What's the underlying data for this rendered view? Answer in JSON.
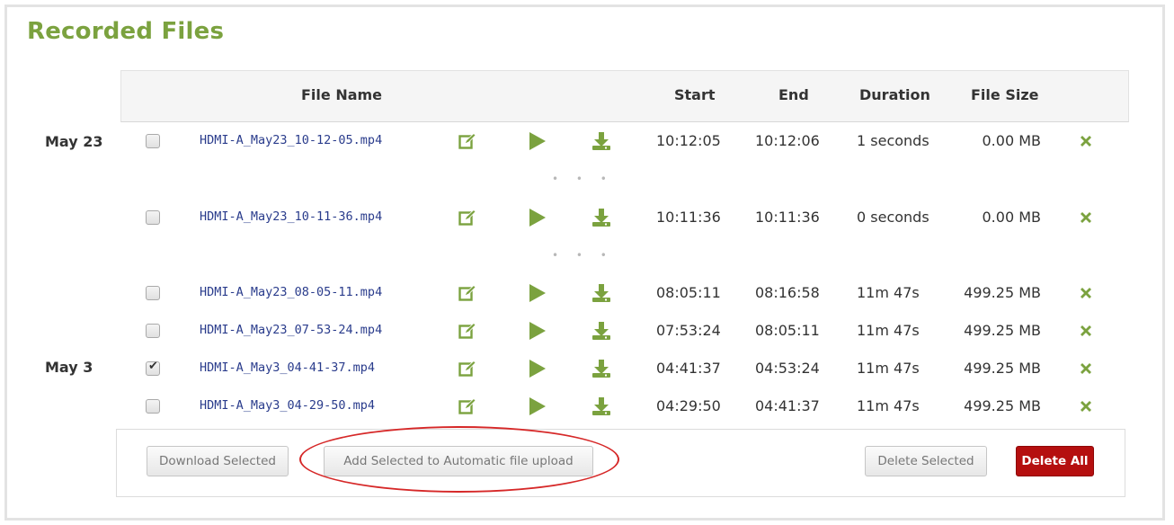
{
  "page": {
    "title": "Recorded Files"
  },
  "table": {
    "headers": {
      "file_name": "File Name",
      "start": "Start",
      "end": "End",
      "duration": "Duration",
      "file_size": "File Size"
    },
    "date_labels": [
      "May 23",
      "May 3"
    ],
    "rows": [
      {
        "file": "HDMI-A_May23_10-12-05.mp4",
        "start": "10:12:05",
        "end": "10:12:06",
        "duration": "1 seconds",
        "size": "0.00 MB",
        "checked": false
      },
      {
        "file": "HDMI-A_May23_10-11-36.mp4",
        "start": "10:11:36",
        "end": "10:11:36",
        "duration": "0 seconds",
        "size": "0.00 MB",
        "checked": false
      },
      {
        "file": "HDMI-A_May23_08-05-11.mp4",
        "start": "08:05:11",
        "end": "08:16:58",
        "duration": "11m 47s",
        "size": "499.25 MB",
        "checked": false
      },
      {
        "file": "HDMI-A_May23_07-53-24.mp4",
        "start": "07:53:24",
        "end": "08:05:11",
        "duration": "11m 47s",
        "size": "499.25 MB",
        "checked": false
      },
      {
        "file": "HDMI-A_May3_04-41-37.mp4",
        "start": "04:41:37",
        "end": "04:53:24",
        "duration": "11m 47s",
        "size": "499.25 MB",
        "checked": true
      },
      {
        "file": "HDMI-A_May3_04-29-50.mp4",
        "start": "04:29:50",
        "end": "04:41:37",
        "duration": "11m 47s",
        "size": "499.25 MB",
        "checked": false
      }
    ],
    "ellipsis": "• • •"
  },
  "footer": {
    "download_selected": "Download Selected",
    "add_selected": "Add Selected to Automatic file upload",
    "delete_selected": "Delete Selected",
    "delete_all": "Delete All"
  },
  "icons": {
    "edit": "edit-icon",
    "play": "play-icon",
    "download": "download-icon",
    "delete": "delete-x-icon"
  },
  "colors": {
    "accent_green": "#7ba23f",
    "link_blue": "#2a3c8c",
    "danger_red": "#b50f0f",
    "highlight": "#d62828"
  }
}
